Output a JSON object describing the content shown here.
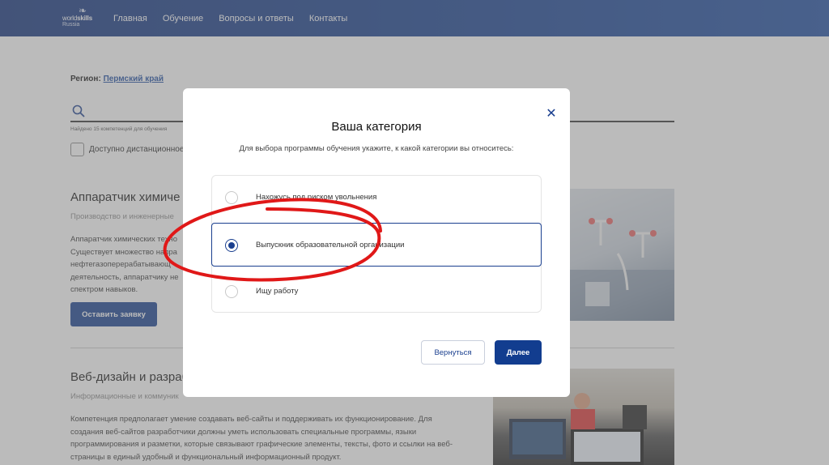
{
  "header": {
    "logo": {
      "line1_light": "world",
      "line1_bold": "skills",
      "line2": "Russia"
    },
    "nav": [
      "Главная",
      "Обучение",
      "Вопросы и ответы",
      "Контакты"
    ]
  },
  "page": {
    "region_label": "Регион:",
    "region_value": "Пермский край",
    "found_text": "Найдено 15 компетенций для обучения",
    "remote_checkbox_label": "Доступно дистанционное",
    "card1": {
      "title": "Аппаратчик химиче",
      "subtitle": "Производство и инженерные",
      "text": [
        "Аппаратчик химических техно",
        "Существует множество напра",
        "нефтегазоперерабатывающ",
        "деятельность, аппаратчику не",
        "спектром навыков."
      ],
      "button": "Оставить заявку"
    },
    "card2": {
      "title": "Веб-дизайн и разраб",
      "subtitle": "Информационные и коммуник",
      "text": [
        "Компетенция предполагает умение создавать веб-сайты и поддерживать их функционирование. Для",
        "создания веб-сайтов разработчики должны уметь использовать специальные программы, языки",
        "программирования и разметки, которые связывают графические элементы, тексты, фото и ссылки на веб-",
        "страницы в единый удобный и функциональный информационный продукт."
      ]
    }
  },
  "modal": {
    "title": "Ваша категория",
    "description": "Для выбора программы обучения укажите, к какой категории вы относитесь:",
    "options": [
      {
        "label": "Нахожусь под риском увольнения",
        "selected": false
      },
      {
        "label": "Выпускник образовательной организации",
        "selected": true
      },
      {
        "label": "Ищу работу",
        "selected": false
      }
    ],
    "back_button": "Вернуться",
    "next_button": "Далее"
  },
  "colors": {
    "header_blue": "#123d8f",
    "accent_blue": "#1a3f8f",
    "annotation_red": "#e01818"
  }
}
